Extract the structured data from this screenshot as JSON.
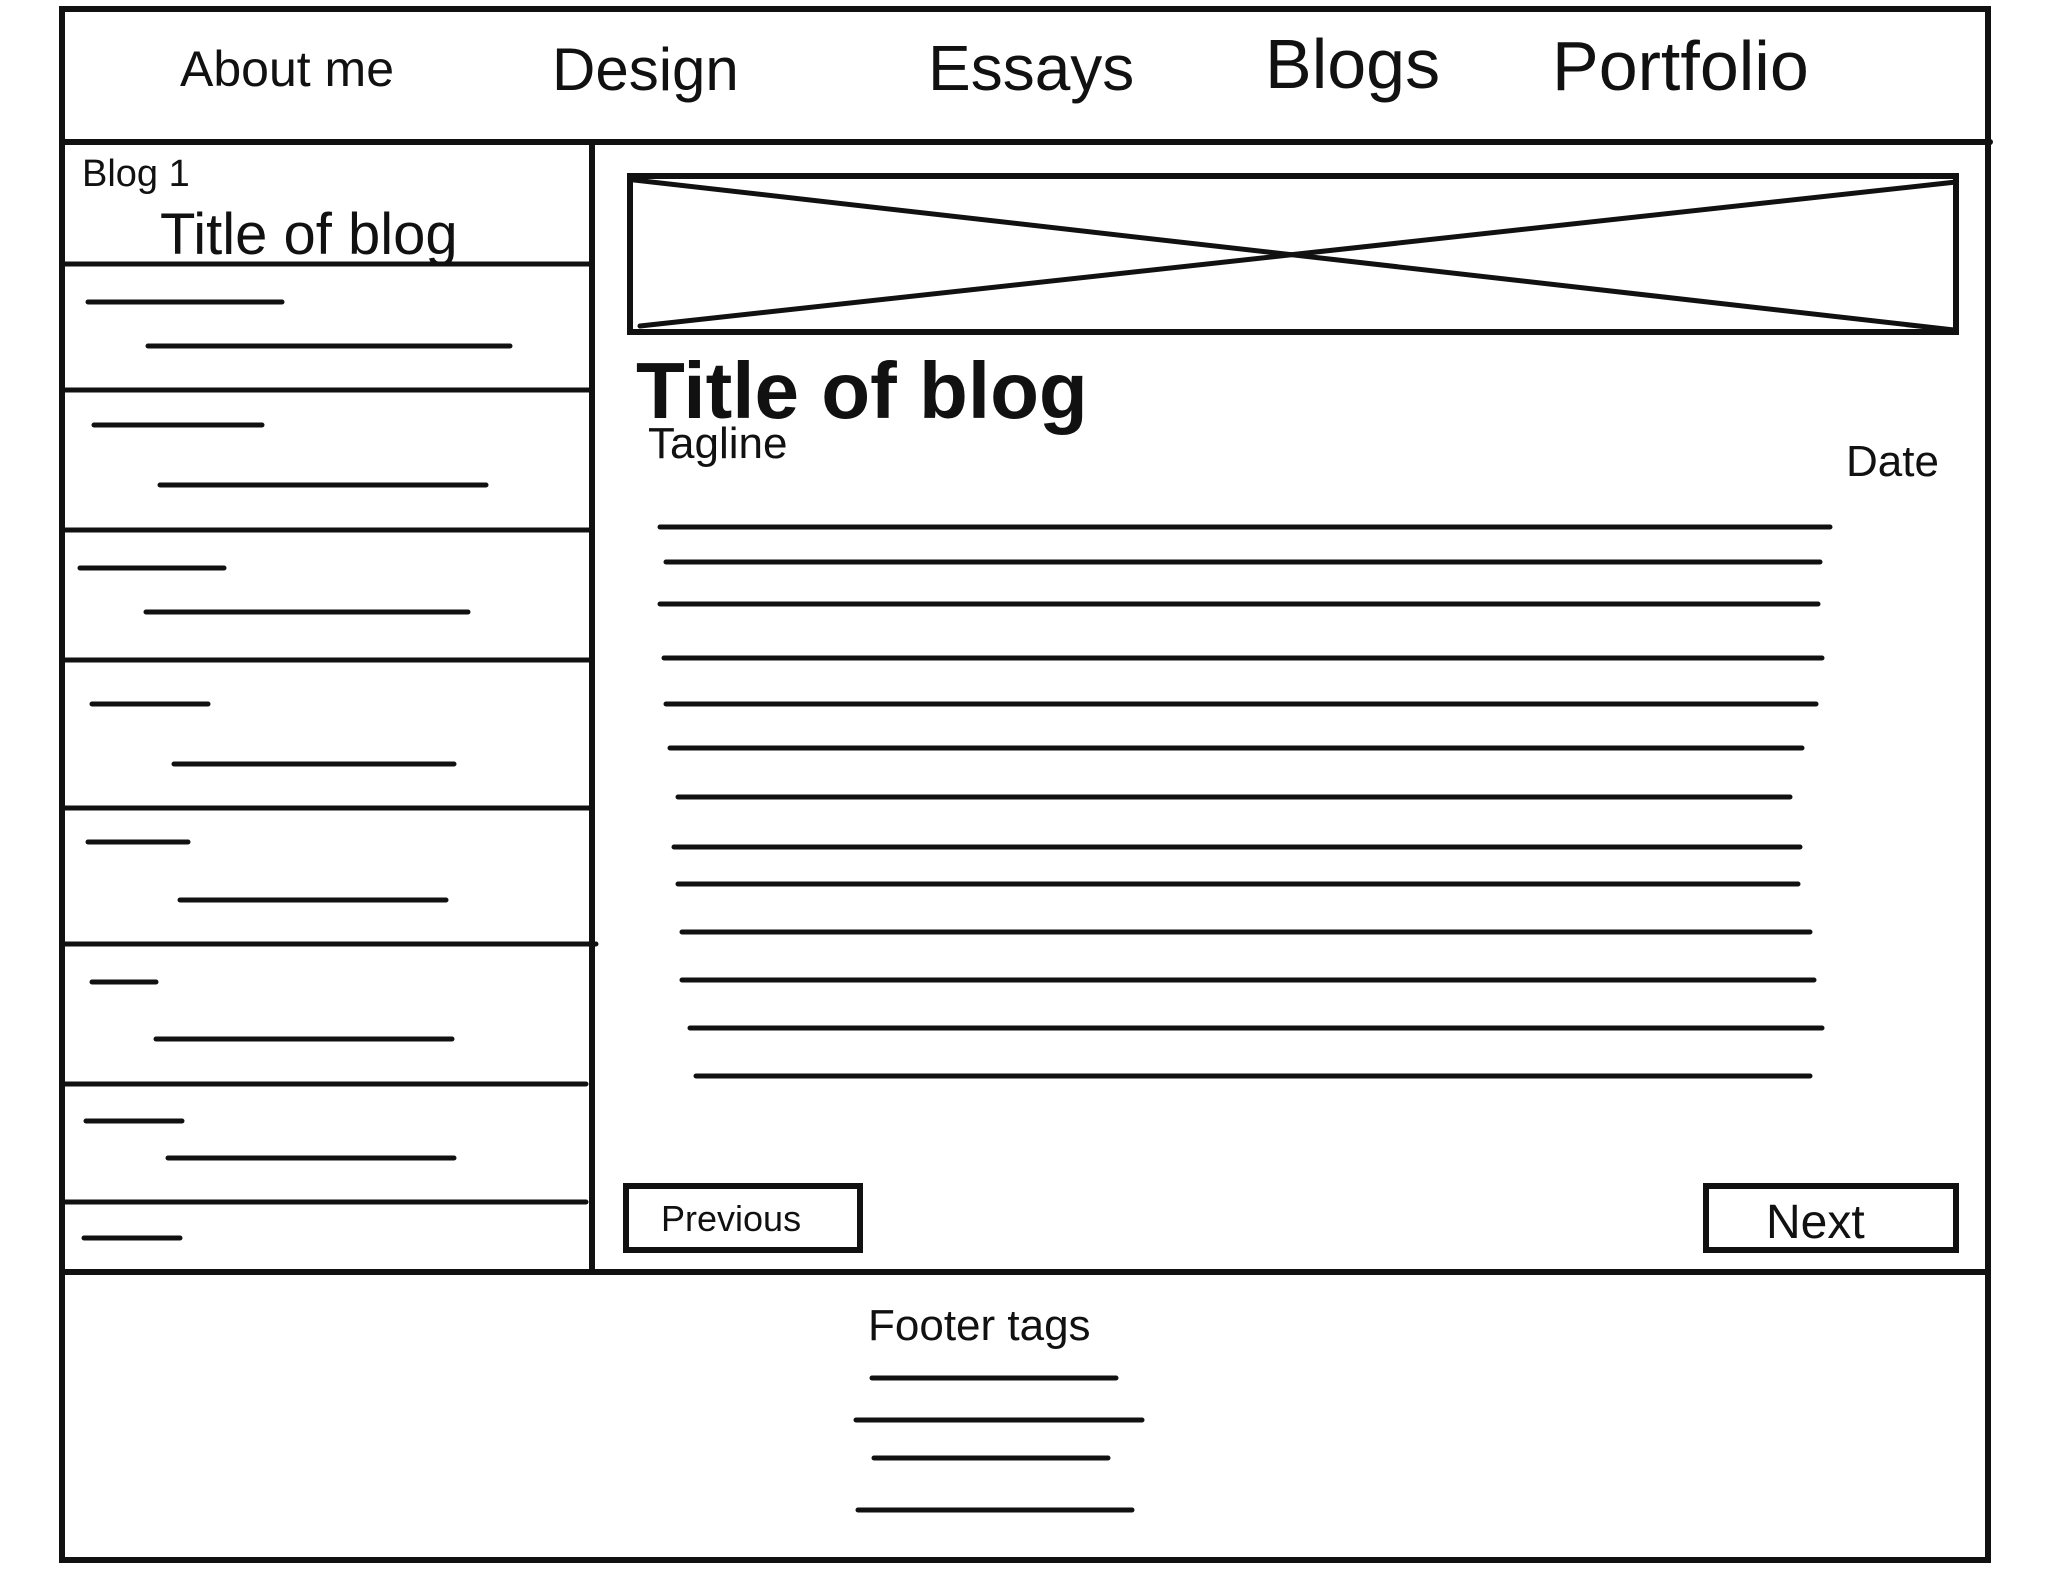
{
  "nav": {
    "items": [
      {
        "label": "About me"
      },
      {
        "label": "Design"
      },
      {
        "label": "Essays"
      },
      {
        "label": "Blogs"
      },
      {
        "label": "Portfolio"
      }
    ]
  },
  "sidebar": {
    "blog_label": "Blog 1",
    "title": "Title of blog"
  },
  "main": {
    "image_placeholder": "image-placeholder",
    "title": "Title of blog",
    "tagline": "Tagline",
    "date": "Date",
    "previous_label": "Previous",
    "next_label": "Next"
  },
  "footer": {
    "title": "Footer tags"
  },
  "colors": {
    "ink": "#111111",
    "background": "#ffffff"
  }
}
